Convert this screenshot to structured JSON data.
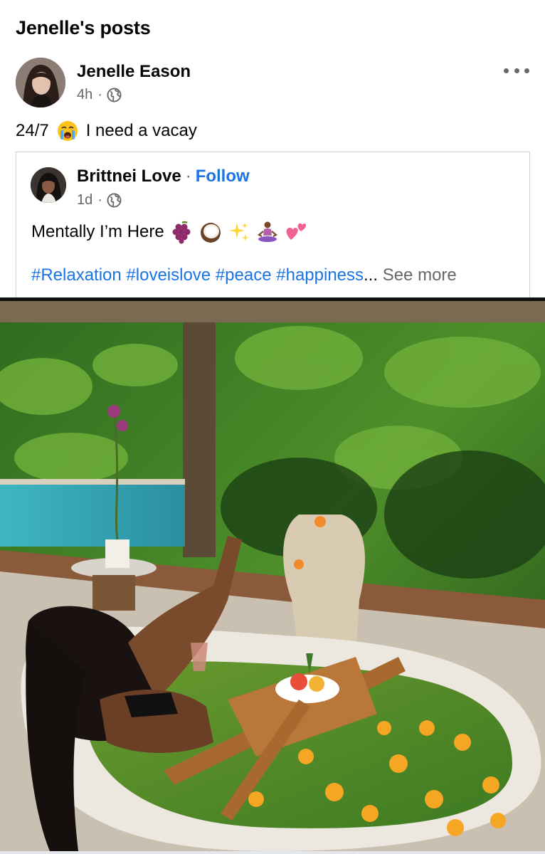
{
  "page": {
    "title": "Jenelle's posts"
  },
  "post": {
    "author": "Jenelle Eason",
    "time": "4h",
    "separator": "·",
    "text_before": "24/7",
    "text_after": "I need a vacay",
    "icons": [
      "globe-icon",
      "crying-face-emoji",
      "more-options-icon"
    ]
  },
  "shared_post": {
    "author": "Brittnei Love",
    "separator": "·",
    "follow_label": "Follow",
    "time": "1d",
    "text": "Mentally I’m Here",
    "emojis": [
      "grapes-emoji",
      "coconut-emoji",
      "sparkles-emoji",
      "meditating-person-emoji",
      "two-hearts-emoji"
    ],
    "hashtags": [
      "#Relaxation",
      "#loveislove",
      "#peace",
      "#happiness"
    ],
    "hashtag_ellipsis": "...",
    "see_more_label": "See more"
  },
  "photo": {
    "subject": "image-bathtub-tropical-resort"
  },
  "colors": {
    "link": "#1b74e4",
    "secondary_text": "#65676b",
    "border": "#ced0d4"
  }
}
